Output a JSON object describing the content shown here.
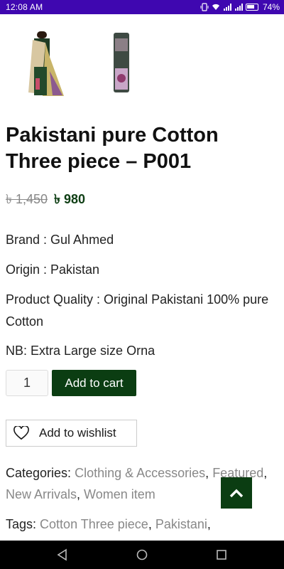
{
  "status_bar": {
    "time": "12:08 AM",
    "battery": "74%",
    "icons": [
      "vibrate-icon",
      "wifi-icon",
      "signal-icon",
      "signal-icon",
      "battery-icon"
    ]
  },
  "product": {
    "title": "Pakistani pure Cotton Three piece – P001",
    "old_price": "৳ 1,450",
    "new_price": "৳ 980",
    "brand": "Brand : Gul Ahmed",
    "origin": "Origin : Pakistan",
    "quality": "Product Quality : Original Pakistani 100% pure Cotton",
    "note": "NB: Extra Large size Orna",
    "quantity": "1",
    "add_to_cart": "Add to cart",
    "add_to_wishlist": "Add to wishlist",
    "categories_label": "Categories:",
    "categories": [
      "Clothing & Accessories",
      "Featured",
      "New Arrivals",
      "Women item"
    ],
    "tags_label": "Tags:",
    "tags": [
      "Cotton Three piece",
      "Pakistani"
    ]
  },
  "colors": {
    "status_bar": "#3f07b0",
    "brand_green": "#0b3d12"
  }
}
